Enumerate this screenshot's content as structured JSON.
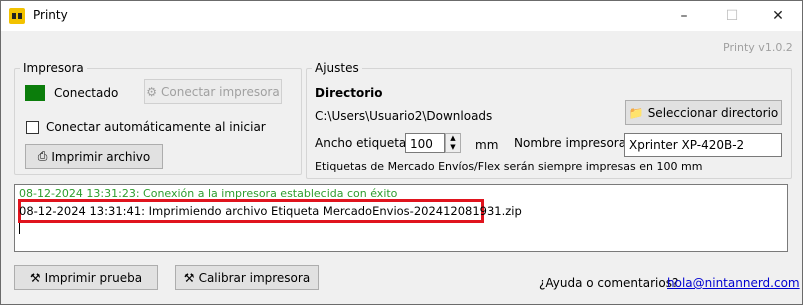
{
  "window": {
    "title": "Printy",
    "version": "Printy v1.0.2"
  },
  "printer_group": {
    "legend": "Impresora",
    "status_text": "Conectado",
    "status_color": "#0b7d0b",
    "connect_button": "Conectar impresora",
    "auto_connect_label": "Conectar automáticamente al iniciar",
    "print_file_button": "Imprimir archivo"
  },
  "settings_group": {
    "legend": "Ajustes",
    "directory_heading": "Directorio",
    "directory_path": "C:\\Users\\Usuario2\\Downloads",
    "select_dir_button": "Seleccionar directorio",
    "width_label": "Ancho etiqueta",
    "width_value": "100",
    "width_unit": "mm",
    "printer_name_label": "Nombre impresora",
    "printer_name_value": "Xprinter XP-420B-2",
    "note": "Etiquetas de Mercado Envíos/Flex serán siempre impresas en 100 mm"
  },
  "log": {
    "lines": [
      "08-12-2024 13:31:23: Conexión a la impresora establecida con éxito",
      "08-12-2024 13:31:41: Imprimiendo archivo Etiqueta MercadoEnvios-202412081931.zip"
    ]
  },
  "footer": {
    "test_button": "Imprimir prueba",
    "calibrate_button": "Calibrar impresora",
    "help_text": "¿Ayuda o comentarios?",
    "email": "hola@nintannerd.com"
  },
  "colors": {
    "highlight": "#e0141e",
    "success_text": "#2e9d2e",
    "link": "#0000d0"
  }
}
